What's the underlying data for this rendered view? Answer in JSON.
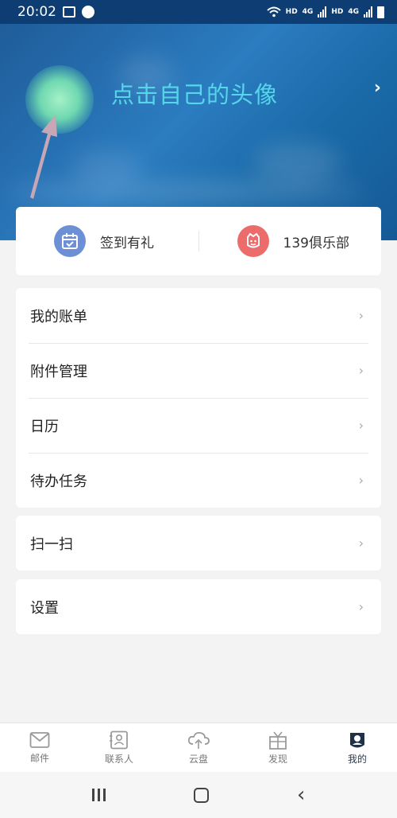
{
  "status_bar": {
    "time": "20:02",
    "hd1": "HD",
    "net1": "4G",
    "hd2": "HD",
    "net2": "4G"
  },
  "header": {
    "hint": "点击自己的头像",
    "chevron": "›"
  },
  "quick": [
    {
      "label": "签到有礼",
      "icon": "calendar-check-icon",
      "color": "#6c8fd6"
    },
    {
      "label": "139俱乐部",
      "icon": "club-icon",
      "color": "#ec6b6b"
    }
  ],
  "menu_group1": [
    {
      "label": "我的账单"
    },
    {
      "label": "附件管理"
    },
    {
      "label": "日历"
    },
    {
      "label": "待办任务"
    }
  ],
  "menu_scan": {
    "label": "扫一扫"
  },
  "menu_settings": {
    "label": "设置"
  },
  "chevron": "›",
  "tabs": [
    {
      "label": "邮件",
      "icon": "mail-icon"
    },
    {
      "label": "联系人",
      "icon": "contacts-icon"
    },
    {
      "label": "云盘",
      "icon": "cloud-icon"
    },
    {
      "label": "发现",
      "icon": "gift-icon"
    },
    {
      "label": "我的",
      "icon": "profile-icon",
      "active": true
    }
  ],
  "colors": {
    "accent": "#55d6ea",
    "header_bg": "#1f5c9a",
    "active_tab": "#1e3148"
  }
}
